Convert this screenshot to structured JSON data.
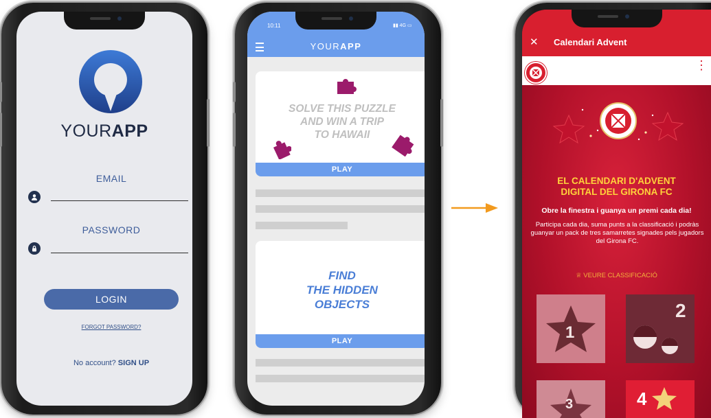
{
  "phone1": {
    "brand_light": "YOUR",
    "brand_bold": "APP",
    "email_label": "EMAIL",
    "password_label": "PASSWORD",
    "login_label": "LOGIN",
    "forgot_label": "FORGOT PASSWORD?",
    "signup_prefix": "No account?",
    "signup_link": "SIGN UP",
    "logo_color": "#2f5fb8"
  },
  "phone2": {
    "status_time": "10:11",
    "status_signal": "4G",
    "title_light": "YOUR",
    "title_bold": "APP",
    "card1_text": [
      "SOLVE THIS PUZZLE",
      "AND WIN A TRIP",
      "TO HAWAII"
    ],
    "card1_play": "PLAY",
    "card2_text": [
      "FIND",
      "THE HIDDEN",
      "OBJECTS"
    ],
    "card2_play": "PLAY",
    "accent_color": "#6b9dec",
    "puzzle_color": "#9b1b6b"
  },
  "phone3": {
    "close_icon": "close-icon",
    "title": "Calendari Advent",
    "heading_line1": "EL CALENDARI D'ADVENT",
    "heading_line2": "DIGITAL DEL GIRONA FC",
    "subheading": "Obre la finestra i guanya un premi cada dia!",
    "paragraph": "Participa cada dia, suma punts a la classificació i podràs guanyar un pack de tres samarretes signades pels jugadors del Girona FC.",
    "ranking_label": "VEURE CLASSIFICACIÓ",
    "tile_numbers": [
      "1",
      "2",
      "3",
      "4"
    ],
    "brand_red": "#d81f2f",
    "accent_yellow": "#ffd33b"
  }
}
